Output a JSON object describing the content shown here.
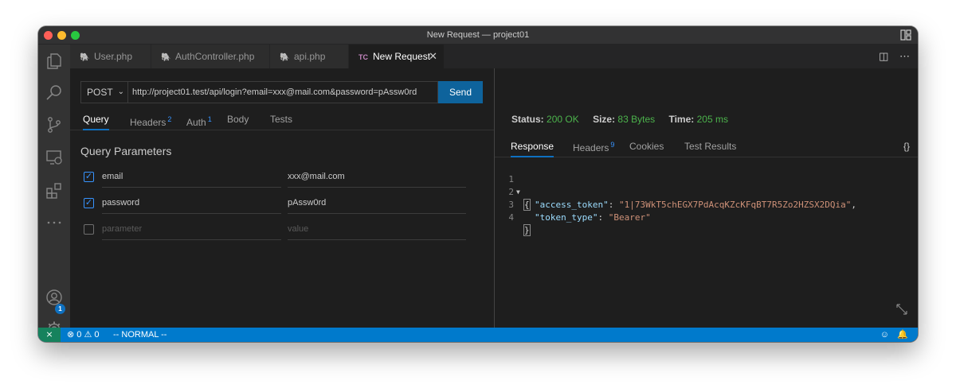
{
  "window": {
    "title": "New Request — project01"
  },
  "activity_bar": {
    "account_badge": "1"
  },
  "tabs": [
    {
      "label": "User.php",
      "icon": "php-elephant-icon"
    },
    {
      "label": "AuthController.php",
      "icon": "php-elephant-icon"
    },
    {
      "label": "api.php",
      "icon": "php-elephant-icon"
    },
    {
      "label": "New Request",
      "icon": "TC"
    }
  ],
  "request": {
    "method": "POST",
    "url": "http://project01.test/api/login?email=xxx@mail.com&password=pAssw0rd",
    "send_label": "Send",
    "tabs": [
      {
        "label": "Query",
        "count": ""
      },
      {
        "label": "Headers",
        "count": "2"
      },
      {
        "label": "Auth",
        "count": "1"
      },
      {
        "label": "Body",
        "count": ""
      },
      {
        "label": "Tests",
        "count": ""
      }
    ],
    "query_title": "Query Parameters",
    "params": [
      {
        "key": "email",
        "value": "xxx@mail.com",
        "checked": true
      },
      {
        "key": "password",
        "value": "pAssw0rd",
        "checked": true
      }
    ],
    "placeholder_key": "parameter",
    "placeholder_value": "value"
  },
  "response": {
    "status_label": "Status:",
    "status_value": "200 OK",
    "size_label": "Size:",
    "size_value": "83 Bytes",
    "time_label": "Time:",
    "time_value": "205 ms",
    "tabs": [
      {
        "label": "Response",
        "count": ""
      },
      {
        "label": "Headers",
        "count": "9"
      },
      {
        "label": "Cookies",
        "count": ""
      },
      {
        "label": "Test Results",
        "count": ""
      }
    ],
    "format_label": "{}",
    "lines": [
      {
        "num": "1",
        "open": "{"
      },
      {
        "num": "2",
        "key": "\"access_token\"",
        "sep": ": ",
        "val": "\"1|73WkT5chEGX7PdAcqKZcKFqBT7R5Zo2HZSX2DQia\"",
        "end": ","
      },
      {
        "num": "3",
        "key": "\"token_type\"",
        "sep": ": ",
        "val": "\"Bearer\"",
        "end": ""
      },
      {
        "num": "4",
        "open": "}"
      }
    ]
  },
  "statusbar": {
    "errors": "0",
    "warnings": "0",
    "mode": "-- NORMAL --"
  },
  "colors": {
    "accent": "#007acc",
    "send": "#0e639c",
    "ok": "#4cb34c",
    "remote": "#16825d"
  }
}
